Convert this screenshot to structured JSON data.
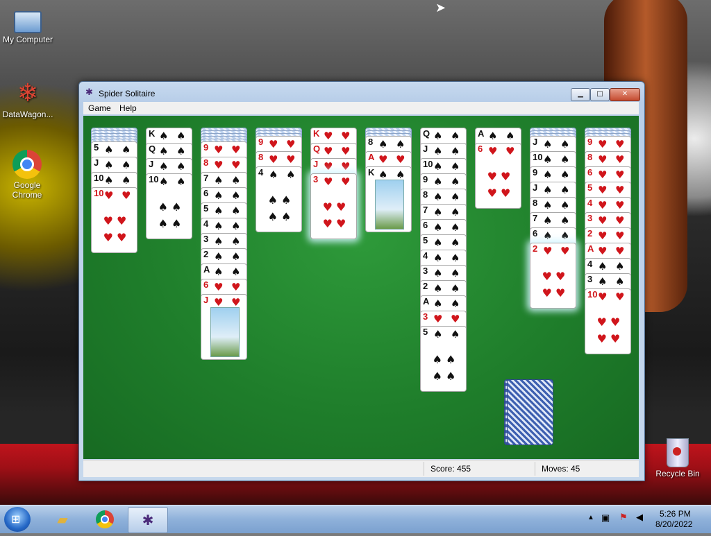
{
  "desktop": {
    "icons": [
      {
        "label": "My Computer"
      },
      {
        "label": "DataWagon..."
      },
      {
        "label": "Google Chrome"
      },
      {
        "label": "Recycle Bin"
      }
    ]
  },
  "window": {
    "title": "Spider Solitaire",
    "icon": "spider-icon",
    "controls": {
      "minimize": "▁",
      "maximize": "□",
      "close": "✕"
    },
    "menu": [
      "Game",
      "Help"
    ],
    "status": {
      "score_label": "Score: 455",
      "moves_label": "Moves:  45"
    }
  },
  "suit_symbols": {
    "spade": "♠",
    "heart": "♥"
  },
  "tableau": [
    {
      "face_down": 5,
      "cards": [
        {
          "rank": "5",
          "suit": "spade"
        },
        {
          "rank": "J",
          "suit": "spade",
          "face": true
        },
        {
          "rank": "10",
          "suit": "spade"
        },
        {
          "rank": "10",
          "suit": "heart"
        }
      ]
    },
    {
      "face_down": 0,
      "cards": [
        {
          "rank": "K",
          "suit": "spade",
          "face": true
        },
        {
          "rank": "Q",
          "suit": "spade",
          "face": true
        },
        {
          "rank": "J",
          "suit": "spade",
          "face": true
        },
        {
          "rank": "10",
          "suit": "spade"
        }
      ]
    },
    {
      "face_down": 5,
      "cards": [
        {
          "rank": "9",
          "suit": "heart"
        },
        {
          "rank": "8",
          "suit": "heart"
        },
        {
          "rank": "7",
          "suit": "spade"
        },
        {
          "rank": "6",
          "suit": "spade"
        },
        {
          "rank": "5",
          "suit": "spade"
        },
        {
          "rank": "4",
          "suit": "spade"
        },
        {
          "rank": "3",
          "suit": "spade"
        },
        {
          "rank": "2",
          "suit": "spade"
        },
        {
          "rank": "A",
          "suit": "spade"
        },
        {
          "rank": "6",
          "suit": "heart"
        },
        {
          "rank": "J",
          "suit": "heart",
          "face": true
        }
      ]
    },
    {
      "face_down": 3,
      "cards": [
        {
          "rank": "9",
          "suit": "heart"
        },
        {
          "rank": "8",
          "suit": "heart"
        },
        {
          "rank": "4",
          "suit": "spade"
        }
      ]
    },
    {
      "face_down": 0,
      "cards": [
        {
          "rank": "K",
          "suit": "heart",
          "face": true
        },
        {
          "rank": "Q",
          "suit": "heart",
          "face": true
        },
        {
          "rank": "J",
          "suit": "heart",
          "face": true
        },
        {
          "rank": "3",
          "suit": "heart",
          "glow": true
        }
      ]
    },
    {
      "face_down": 3,
      "cards": [
        {
          "rank": "8",
          "suit": "spade"
        },
        {
          "rank": "A",
          "suit": "heart"
        },
        {
          "rank": "K",
          "suit": "spade",
          "face": true
        }
      ]
    },
    {
      "face_down": 0,
      "cards": [
        {
          "rank": "Q",
          "suit": "spade",
          "face": true
        },
        {
          "rank": "J",
          "suit": "spade",
          "face": true
        },
        {
          "rank": "10",
          "suit": "spade"
        },
        {
          "rank": "9",
          "suit": "spade"
        },
        {
          "rank": "8",
          "suit": "spade"
        },
        {
          "rank": "7",
          "suit": "spade"
        },
        {
          "rank": "6",
          "suit": "spade"
        },
        {
          "rank": "5",
          "suit": "spade"
        },
        {
          "rank": "4",
          "suit": "spade"
        },
        {
          "rank": "3",
          "suit": "spade"
        },
        {
          "rank": "2",
          "suit": "spade"
        },
        {
          "rank": "A",
          "suit": "spade"
        },
        {
          "rank": "3",
          "suit": "heart"
        },
        {
          "rank": "5",
          "suit": "spade"
        }
      ]
    },
    {
      "face_down": 0,
      "cards": [
        {
          "rank": "A",
          "suit": "spade"
        },
        {
          "rank": "6",
          "suit": "heart"
        }
      ]
    },
    {
      "face_down": 3,
      "cards": [
        {
          "rank": "J",
          "suit": "spade",
          "face": true
        },
        {
          "rank": "10",
          "suit": "spade"
        },
        {
          "rank": "9",
          "suit": "spade"
        },
        {
          "rank": "J",
          "suit": "spade",
          "face": true
        },
        {
          "rank": "8",
          "suit": "spade"
        },
        {
          "rank": "7",
          "suit": "spade"
        },
        {
          "rank": "6",
          "suit": "spade"
        },
        {
          "rank": "2",
          "suit": "heart",
          "glow": true
        }
      ]
    },
    {
      "face_down": 3,
      "cards": [
        {
          "rank": "9",
          "suit": "heart"
        },
        {
          "rank": "8",
          "suit": "heart"
        },
        {
          "rank": "6",
          "suit": "heart"
        },
        {
          "rank": "5",
          "suit": "heart"
        },
        {
          "rank": "4",
          "suit": "heart"
        },
        {
          "rank": "3",
          "suit": "heart"
        },
        {
          "rank": "2",
          "suit": "heart"
        },
        {
          "rank": "A",
          "suit": "heart"
        },
        {
          "rank": "4",
          "suit": "spade"
        },
        {
          "rank": "3",
          "suit": "spade"
        },
        {
          "rank": "10",
          "suit": "heart"
        }
      ]
    }
  ],
  "stock_piles": 3,
  "taskbar": {
    "items": [
      "windows-start-icon",
      "folder-icon",
      "chrome-icon",
      "spider-icon"
    ],
    "tray": {
      "time": "5:26 PM",
      "date": "8/20/2022"
    }
  },
  "colors": {
    "felt": "#1f7e2b",
    "red_suit": "#d0151b",
    "black_suit": "#111111"
  }
}
